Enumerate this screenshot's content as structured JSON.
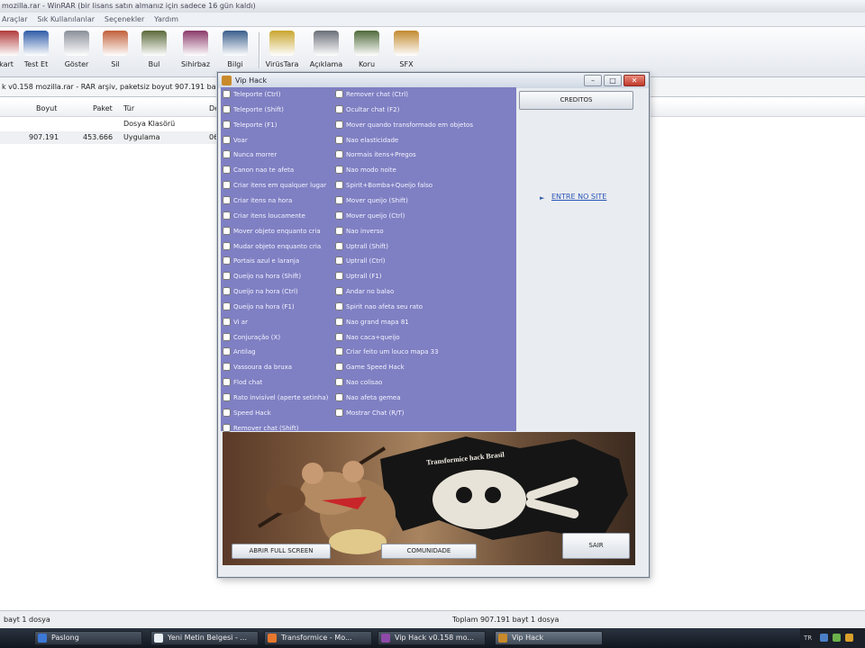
{
  "winrar": {
    "title": "mozilla.rar - WinRAR (bir lisans satın almanız için sadece 16 gün kaldı)",
    "menu": [
      "Araçlar",
      "Sık Kullanılanlar",
      "Seçenekler",
      "Yardım"
    ],
    "toolbar": [
      {
        "label": "kart",
        "icon": "add-icon",
        "color": "#b23b3b"
      },
      {
        "label": "Test Et",
        "icon": "test-icon",
        "color": "#2f5ca8"
      },
      {
        "label": "Göster",
        "icon": "view-icon",
        "color": "#8a8f99"
      },
      {
        "label": "Sil",
        "icon": "delete-icon",
        "color": "#c2603a"
      },
      {
        "label": "Bul",
        "icon": "find-icon",
        "color": "#5b6a3a"
      },
      {
        "label": "Sihirbaz",
        "icon": "wizard-icon",
        "color": "#8b3a6a"
      },
      {
        "label": "Bilgi",
        "icon": "info-icon",
        "color": "#3a5e8b"
      },
      {
        "label": "VirüsTara",
        "icon": "virus-scan-icon",
        "color": "#c9a62f"
      },
      {
        "label": "Açıklama",
        "icon": "comment-icon",
        "color": "#6a6f78"
      },
      {
        "label": "Koru",
        "icon": "protect-icon",
        "color": "#4f6a3a"
      },
      {
        "label": "SFX",
        "icon": "sfx-icon",
        "color": "#c28a2f"
      }
    ],
    "path": "k v0.158 mozilla.rar - RAR arşiv, paketsiz boyut 907.191 ba",
    "columns": [
      "Boyut",
      "Paket",
      "Tür",
      "De"
    ],
    "rows": [
      {
        "size": "",
        "packed": "",
        "type": "Dosya Klasörü",
        "date": ""
      },
      {
        "size": "907.191",
        "packed": "453.666",
        "type": "Uygulama",
        "date": "06"
      }
    ],
    "status_left": "bayt 1 dosya",
    "status_right": "Toplam 907.191 bayt 1 dosya"
  },
  "taskbar": {
    "tasks": [
      "Paslong",
      "Yeni Metin Belgesi - ...",
      "Transformice - Mo...",
      "Vip Hack v0.158 mo...",
      "Vip Hack"
    ],
    "tray_lang": "TR"
  },
  "vip": {
    "title": "Vip Hack",
    "creditos": "CREDITOS",
    "site_link": "ENTRE NO SITE",
    "banner_text": "Transformice hack Brasil",
    "abrir": "ABRIR FULL SCREEN",
    "comunidade": "COMUNIDADE",
    "sair": "SAIR",
    "options_left": [
      "Teleporte (Ctrl)",
      "Teleporte (Shift)",
      "Teleporte (F1)",
      "Voar",
      "Nunca morrer",
      "Canon nao te afeta",
      "Criar itens em qualquer lugar",
      "Criar itens na hora",
      "Criar itens loucamente",
      "Mover objeto enquanto cria",
      "Mudar objeto enquanto cria",
      "Portais azul e laranja",
      "Queijo na hora (Shift)",
      "Queijo na hora (Ctrl)",
      "Queijo na hora (F1)",
      "Vi ar",
      "Conjuração (X)",
      "Antilag",
      "Vassoura da bruxa",
      "Flod chat",
      "Rato invisível (aperte setinha)",
      "Speed Hack",
      "Remover chat (Shift)"
    ],
    "options_right": [
      "Remover chat (Ctrl)",
      "Ocultar chat (F2)",
      "Mover quando transformado em objetos",
      "Nao elasticidade",
      "Normais itens+Pregos",
      "Nao modo noite",
      "Spirit+Bomba+Queijo falso",
      "Mover queijo (Shift)",
      "Mover queijo (Ctrl)",
      "Nao inverso",
      "Uptrall (Shift)",
      "Uptrall (Ctrl)",
      "Uptrall (F1)",
      "Andar no balao",
      "Spirit nao afeta seu rato",
      "Nao grand mapa 81",
      "Nao caca+queijo",
      "Criar feito um louco mapa 33",
      "Game Speed Hack",
      "Nao colisao",
      "Nao afeta gemea",
      "Mostrar Chat (R/T)"
    ]
  }
}
